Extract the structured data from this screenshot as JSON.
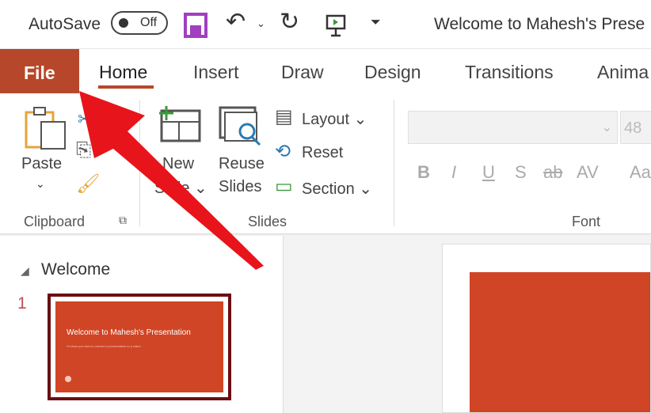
{
  "quick_access": {
    "autosave_label": "AutoSave",
    "autosave_state": "Off",
    "doc_title": "Welcome to Mahesh's Prese"
  },
  "tabs": [
    {
      "label": "File",
      "active": false
    },
    {
      "label": "Home",
      "active": true
    },
    {
      "label": "Insert"
    },
    {
      "label": "Draw"
    },
    {
      "label": "Design"
    },
    {
      "label": "Transitions"
    },
    {
      "label": "Anima"
    }
  ],
  "ribbon": {
    "clipboard": {
      "paste": "Paste",
      "group": "Clipboard"
    },
    "slides": {
      "new_line1": "New",
      "new_line2": "Slide",
      "reuse_line1": "Reuse",
      "reuse_line2": "Slides",
      "layout": "Layout",
      "reset": "Reset",
      "section": "Section",
      "group": "Slides"
    },
    "font": {
      "size": "48",
      "bold": "B",
      "italic": "I",
      "underline": "U",
      "shadow": "S",
      "strike": "ab",
      "spacing": "AV",
      "case": "Aa",
      "group": "Font"
    }
  },
  "slide_pane": {
    "section": "Welcome",
    "slide_number": "1",
    "thumb_title": "Welcome to Mahesh's Presentation",
    "thumb_subtitle": "I'll show you how to convert a presentation to a video"
  },
  "colors": {
    "accent": "#b7472a",
    "slide_bg": "#d04525",
    "arrow": "#e8141b"
  }
}
